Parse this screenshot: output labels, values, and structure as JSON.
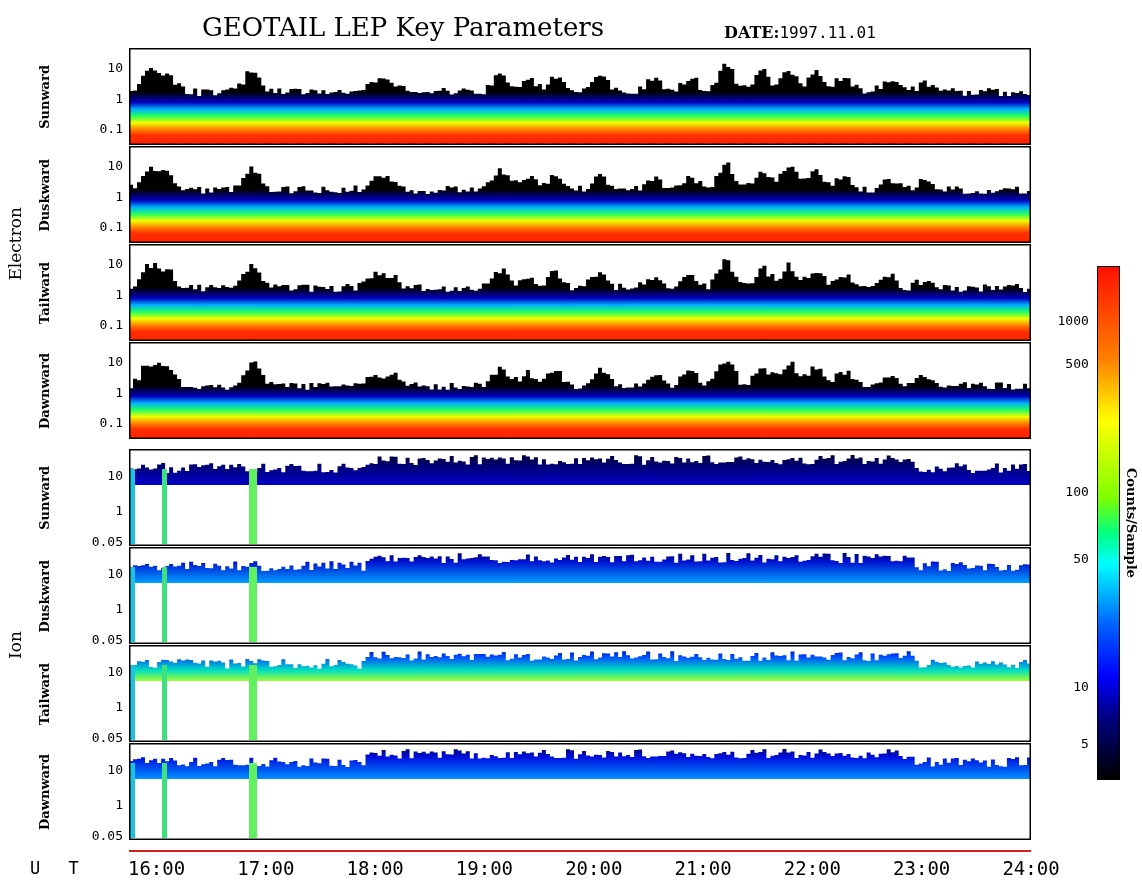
{
  "title": "GEOTAIL LEP Key Parameters",
  "date_label": "DATE:",
  "date": "1997.11.01",
  "groups": [
    {
      "label": "Electron",
      "kind": "electron",
      "panels": [
        {
          "label": "Sunward",
          "ticks": [
            "10",
            "1",
            "0.1"
          ]
        },
        {
          "label": "Duskward",
          "ticks": [
            "10",
            "1",
            "0.1"
          ]
        },
        {
          "label": "Tailward",
          "ticks": [
            "10",
            "1",
            "0.1"
          ]
        },
        {
          "label": "Dawnward",
          "ticks": [
            "10",
            "1",
            "0.1"
          ]
        }
      ]
    },
    {
      "label": "Ion",
      "kind": "ion",
      "panels": [
        {
          "label": "Sunward",
          "ticks": [
            "10",
            "1",
            "0.05"
          ]
        },
        {
          "label": "Duskward",
          "ticks": [
            "10",
            "1",
            "0.05"
          ]
        },
        {
          "label": "Tailward",
          "ticks": [
            "10",
            "1",
            "0.05"
          ]
        },
        {
          "label": "Dawnward",
          "ticks": [
            "10",
            "1",
            "0.05"
          ]
        }
      ]
    }
  ],
  "time_axis": {
    "label": "U T",
    "ticks": [
      "16:00",
      "17:00",
      "18:00",
      "19:00",
      "20:00",
      "21:00",
      "22:00",
      "23:00",
      "24:00"
    ]
  },
  "colorbar": {
    "label": "Counts/Sample",
    "ticks": [
      "1000",
      "500",
      "100",
      "50",
      "10",
      "5"
    ]
  }
}
